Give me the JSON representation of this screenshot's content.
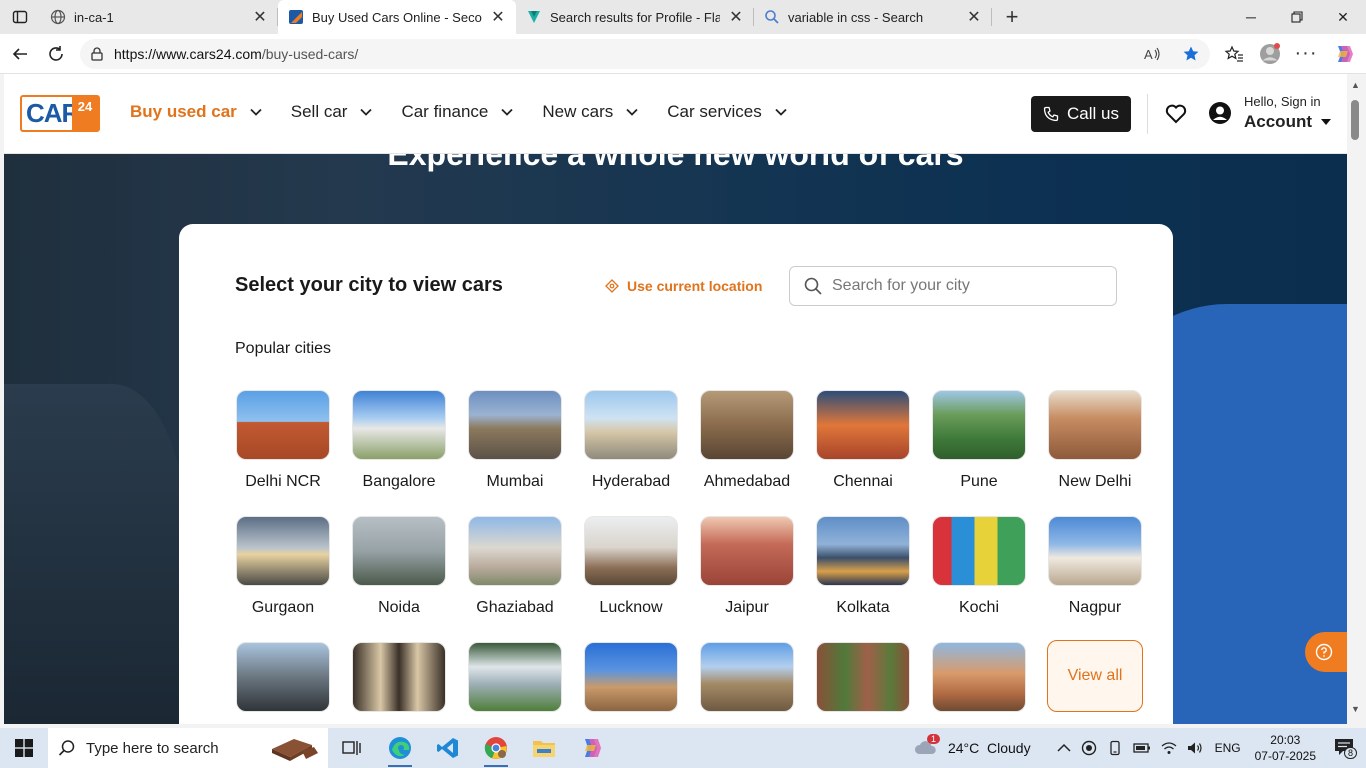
{
  "browser": {
    "tabs": [
      {
        "label": "in-ca-1",
        "icon": "globe-icon"
      },
      {
        "label": "Buy Used Cars Online - Second H",
        "icon": "cars24-favicon",
        "active": true
      },
      {
        "label": "Search results for Profile - Flaticon",
        "icon": "flaticon-favicon"
      },
      {
        "label": "variable in css - Search",
        "icon": "search-icon"
      }
    ],
    "url_host": "https://www.cars24.com",
    "url_path": "/buy-used-cars/"
  },
  "header": {
    "logo_text": "CARS",
    "logo_number": "24",
    "nav": [
      {
        "label": "Buy used car",
        "active": true
      },
      {
        "label": "Sell car"
      },
      {
        "label": "Car finance"
      },
      {
        "label": "New cars"
      },
      {
        "label": "Car services"
      }
    ],
    "call_label": "Call us",
    "hello": "Hello, Sign in",
    "account": "Account"
  },
  "hero": {
    "title": "Experience a whole new world of cars"
  },
  "city_picker": {
    "title": "Select your city to view cars",
    "use_location": "Use current location",
    "search_placeholder": "Search for your city",
    "popular_label": "Popular cities",
    "cities_row1": [
      "Delhi NCR",
      "Bangalore",
      "Mumbai",
      "Hyderabad",
      "Ahmedabad",
      "Chennai",
      "Pune",
      "New Delhi"
    ],
    "cities_row2": [
      "Gurgaon",
      "Noida",
      "Ghaziabad",
      "Lucknow",
      "Jaipur",
      "Kolkata",
      "Kochi",
      "Nagpur"
    ],
    "view_all": "View all"
  },
  "taskbar": {
    "search_placeholder": "Type here to search",
    "weather": "24°C  Cloudy",
    "weather_badge": "1",
    "lang": "ENG",
    "time": "20:03",
    "date": "07-07-2025",
    "notif_count": "8"
  },
  "colors": {
    "brand_orange": "#e0731b",
    "brand_blue": "#1d5aa5"
  }
}
